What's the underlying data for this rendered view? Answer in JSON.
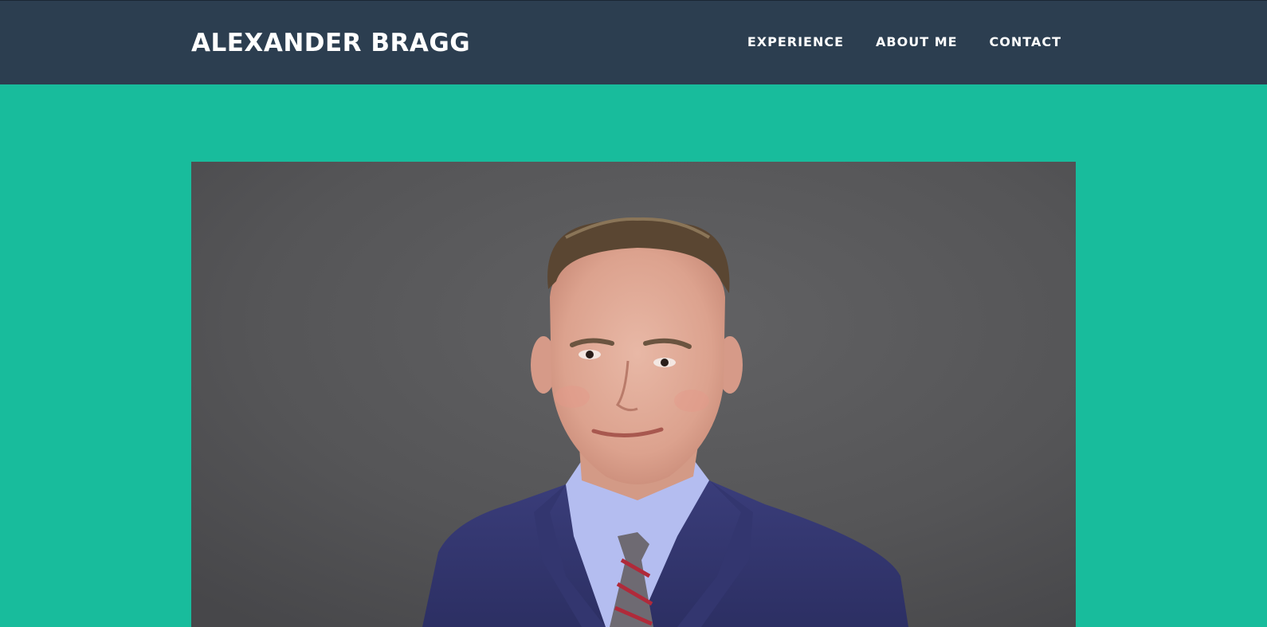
{
  "navbar": {
    "brand": "ALEXANDER BRAGG",
    "links": [
      {
        "label": "EXPERIENCE"
      },
      {
        "label": "ABOUT ME"
      },
      {
        "label": "CONTACT"
      }
    ]
  },
  "hero": {
    "photo_alt": "Portrait photo of Alexander Bragg"
  },
  "colors": {
    "navbar_bg": "#2c3e50",
    "page_bg": "#18bc9c",
    "nav_text": "#ffffff"
  }
}
